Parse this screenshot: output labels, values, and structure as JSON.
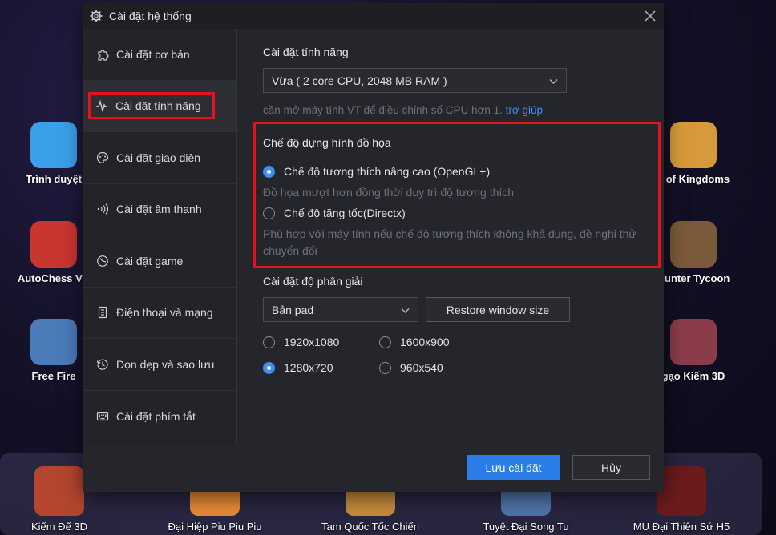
{
  "desktop": {
    "apps": [
      {
        "label": "Trình duyệt",
        "color": "#3aa0ea"
      },
      {
        "label": "AutoChess VN",
        "color": "#c9352f"
      },
      {
        "label": "Free Fire",
        "color": "#4b7bb8"
      },
      {
        "label": "e of Kingdoms",
        "color": "#d69a3a"
      },
      {
        "label": "Hunter Tycoon",
        "color": "#7a5a3a"
      },
      {
        "label": "gạo Kiếm 3D",
        "color": "#8a3c4a"
      }
    ],
    "taskbar": [
      {
        "label": "Kiếm Đế 3D",
        "color": "#b4452f"
      },
      {
        "label": "Đại Hiệp Piu Piu Piu",
        "color": "#e58a36"
      },
      {
        "label": "Tam Quốc Tốc Chiến",
        "color": "#c58b3c"
      },
      {
        "label": "Tuyệt Đại Song Tu",
        "color": "#4f73a8"
      },
      {
        "label": "MU Đại Thiên Sứ H5",
        "color": "#6b1b1b"
      }
    ]
  },
  "dialog": {
    "title": "Cài đặt hệ thống",
    "sidebar": [
      {
        "label": "Cài đặt cơ bản",
        "icon": "puzzle-icon"
      },
      {
        "label": "Cài đặt tính năng",
        "icon": "pulse-icon"
      },
      {
        "label": "Cài đặt giao diện",
        "icon": "palette-icon"
      },
      {
        "label": "Cài đặt âm thanh",
        "icon": "sound-icon"
      },
      {
        "label": "Cài đặt game",
        "icon": "gamepad-icon"
      },
      {
        "label": "Điện thoại và mạng",
        "icon": "phone-icon"
      },
      {
        "label": "Dọn dẹp và sao lưu",
        "icon": "history-icon"
      },
      {
        "label": "Cài đặt phím tắt",
        "icon": "keyboard-icon"
      }
    ],
    "performance": {
      "title": "Cài đặt tính năng",
      "selected": "Vừa ( 2 core CPU, 2048 MB RAM )",
      "hint": "cần mở máy tính VT để điều chỉnh số CPU hơn 1.",
      "help_link": "trợ giúp"
    },
    "render": {
      "title": "Chế độ dựng hình đồ họa",
      "opt1_label": "Chế độ tương thích nâng cao (OpenGL+)",
      "opt1_desc": "Đồ họa mượt hơn đồng thời duy trì độ tương thích",
      "opt2_label": "Chế độ tăng tốc(Directx)",
      "opt2_desc": "Phù hợp với máy tính nếu chế độ tương thích không khả dụng, đề nghị thử chuyển đổi",
      "selected": "opt1"
    },
    "resolution": {
      "title": "Cài đặt độ phân giải",
      "selected": "Bản pad",
      "restore_label": "Restore window size",
      "options": [
        "1920x1080",
        "1600x900",
        "1280x720",
        "960x540"
      ],
      "checked": "1280x720"
    },
    "save_label": "Lưu cài đặt",
    "cancel_label": "Hủy"
  }
}
